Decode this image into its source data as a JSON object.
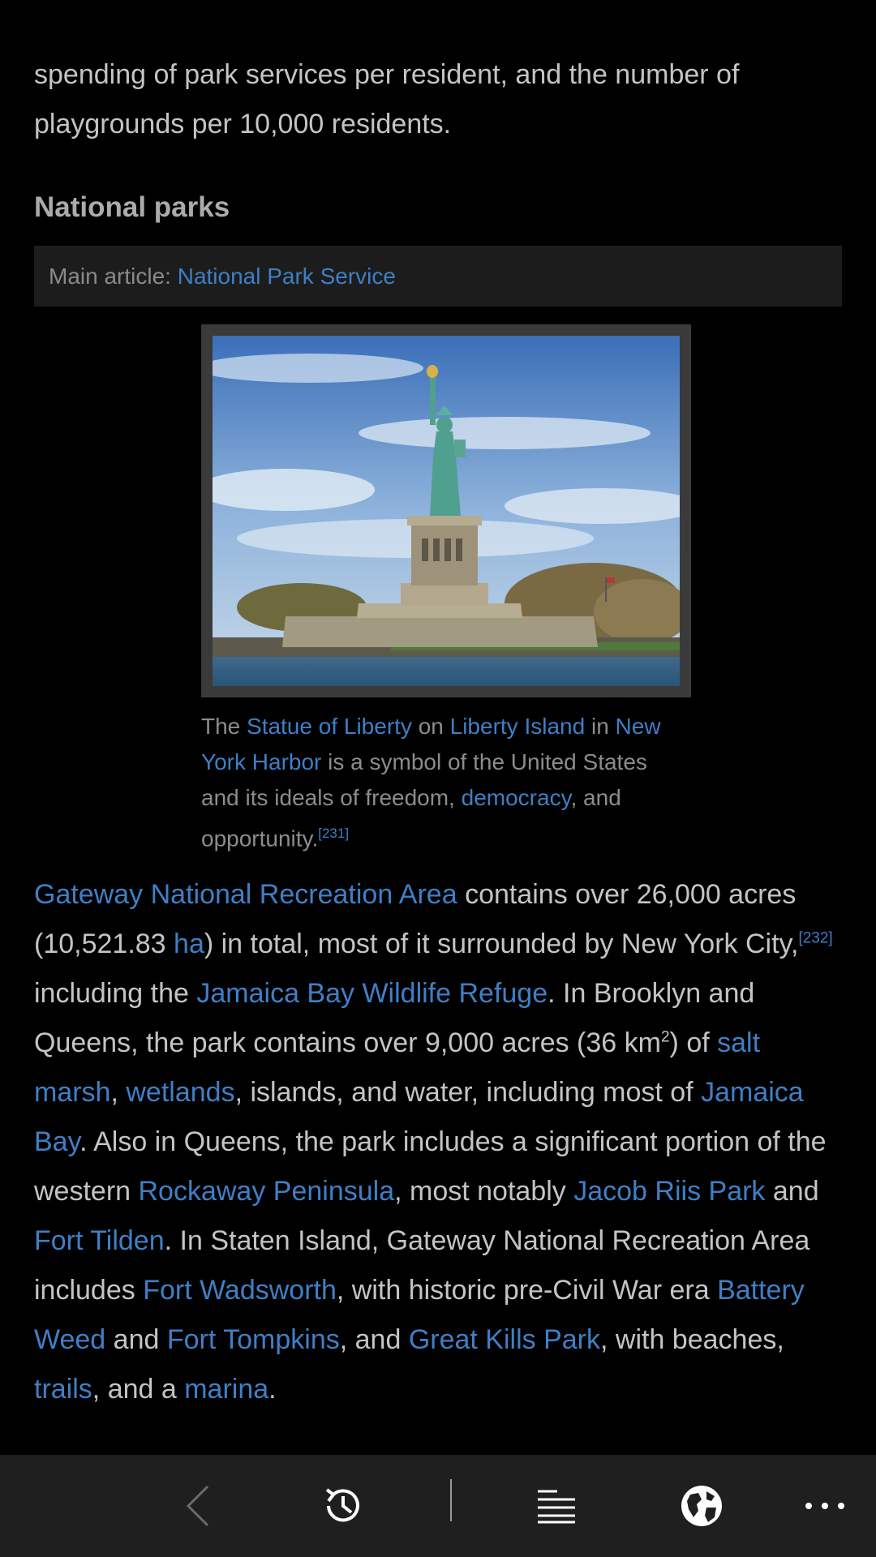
{
  "intro": {
    "text": "spending of park services per resident, and the number of playgrounds per 10,000 residents."
  },
  "section": {
    "heading": "National parks",
    "hatnote_prefix": "Main article: ",
    "hatnote_link": "National Park Service"
  },
  "figure": {
    "image_alt": "Statue of Liberty on Liberty Island",
    "caption": {
      "t1": "The ",
      "l1": "Statue of Liberty",
      "t2": " on ",
      "l2": "Liberty Island",
      "t3": " in ",
      "l3": "New York Harbor",
      "t4": " is a symbol of the United States and its ideals of freedom, ",
      "l4": "democracy",
      "t5": ", and opportunity.",
      "ref": "[231]"
    }
  },
  "para": {
    "l1": "Gateway National Recreation Area",
    "t1": " contains over 26,000 acres (10,521.83 ",
    "l2": "ha",
    "t2": ") in total, most of it surrounded by New York City,",
    "ref": "[232]",
    "t3": " including the ",
    "l3": "Jamaica Bay Wildlife Refuge",
    "t4": ". In Brooklyn and Queens, the park contains over 9,000 acres (36 km",
    "sup2": "2",
    "t5": ") of ",
    "l4": "salt marsh",
    "t6": ", ",
    "l5": "wetlands",
    "t7": ", islands, and water, including most of ",
    "l6": "Jamaica Bay",
    "t8": ". Also in Queens, the park includes a significant portion of the western ",
    "l7": "Rockaway Peninsula",
    "t9": ", most notably ",
    "l8": "Jacob Riis Park",
    "t10": " and ",
    "l9": "Fort Tilden",
    "t11": ". In Staten Island, Gateway National Recreation Area includes ",
    "l10": "Fort Wadsworth",
    "t12": ", with historic pre-Civil War era ",
    "l11": "Battery Weed",
    "t13": " and ",
    "l12": "Fort Tompkins",
    "t14": ", and ",
    "l13": "Great Kills Park",
    "t15": ", with beaches, ",
    "l14": "trails",
    "t16": ", and a ",
    "l15": "marina",
    "t17": "."
  },
  "toolbar": {
    "icons": [
      "back-icon",
      "history-icon",
      "contents-icon",
      "globe-icon",
      "more-icon"
    ],
    "color": "#ffffff",
    "disabled_color": "#6a6a6a",
    "background": "#1f1f1f"
  }
}
